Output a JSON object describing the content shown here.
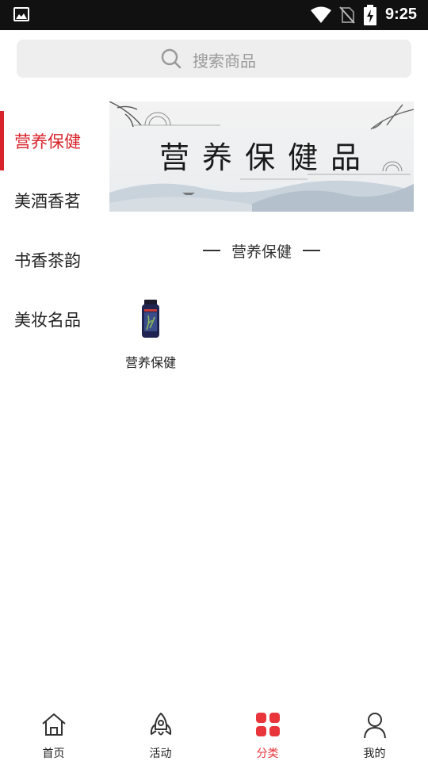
{
  "status_bar": {
    "time": "9:25",
    "icons": [
      "image-icon",
      "wifi-icon",
      "no-sim-icon",
      "battery-charging-icon"
    ]
  },
  "search": {
    "placeholder": "搜索商品",
    "icon": "search-icon"
  },
  "sidebar": {
    "active_color": "#d8232a",
    "items": [
      {
        "label": "营养保健",
        "active": true
      },
      {
        "label": "美酒香茗",
        "active": false
      },
      {
        "label": "书香茶韵",
        "active": false
      },
      {
        "label": "美妆名品",
        "active": false
      }
    ]
  },
  "banner": {
    "title": "营养保健品"
  },
  "section": {
    "title": "营养保健"
  },
  "products": [
    {
      "name": "营养保健",
      "icon": "supplement-bottle-icon"
    }
  ],
  "tabbar": {
    "active_color": "#e8343b",
    "items": [
      {
        "label": "首页",
        "icon": "home-icon",
        "active": false
      },
      {
        "label": "活动",
        "icon": "rocket-icon",
        "active": false
      },
      {
        "label": "分类",
        "icon": "grid-category-icon",
        "active": true
      },
      {
        "label": "我的",
        "icon": "user-icon",
        "active": false
      }
    ]
  }
}
